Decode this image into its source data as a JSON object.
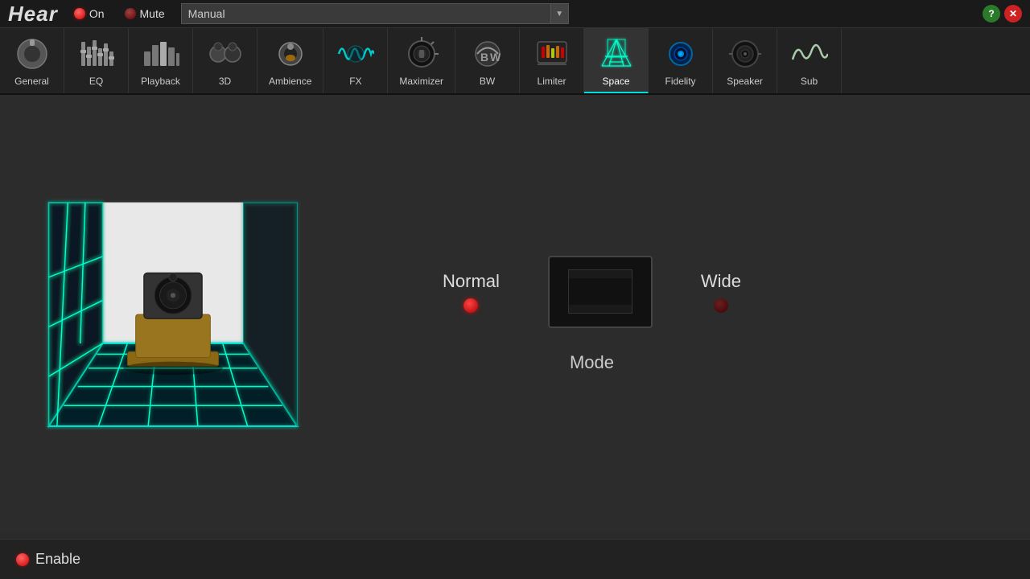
{
  "app": {
    "title": "Hear",
    "logo": "Hear"
  },
  "header": {
    "on_label": "On",
    "mute_label": "Mute",
    "preset_value": "Manual",
    "preset_placeholder": "Manual"
  },
  "tabs": [
    {
      "id": "general",
      "label": "General",
      "active": false
    },
    {
      "id": "eq",
      "label": "EQ",
      "active": false
    },
    {
      "id": "playback",
      "label": "Playback",
      "active": false
    },
    {
      "id": "3d",
      "label": "3D",
      "active": false
    },
    {
      "id": "ambience",
      "label": "Ambience",
      "active": false
    },
    {
      "id": "fx",
      "label": "FX",
      "active": false
    },
    {
      "id": "maximizer",
      "label": "Maximizer",
      "active": false
    },
    {
      "id": "bw",
      "label": "BW",
      "active": false
    },
    {
      "id": "limiter",
      "label": "Limiter",
      "active": false
    },
    {
      "id": "space",
      "label": "Space",
      "active": true
    },
    {
      "id": "fidelity",
      "label": "Fidelity",
      "active": false
    },
    {
      "id": "speaker",
      "label": "Speaker",
      "active": false
    },
    {
      "id": "sub",
      "label": "Sub",
      "active": false
    }
  ],
  "space": {
    "normal_label": "Normal",
    "wide_label": "Wide",
    "mode_label": "Mode",
    "normal_active": true,
    "wide_active": false
  },
  "bottom": {
    "enable_label": "Enable"
  },
  "colors": {
    "active_dot": "#cc0000",
    "inactive_dot": "#550000",
    "cyan": "#00cccc",
    "tab_bg": "#222222",
    "active_tab_bg": "#333333"
  }
}
